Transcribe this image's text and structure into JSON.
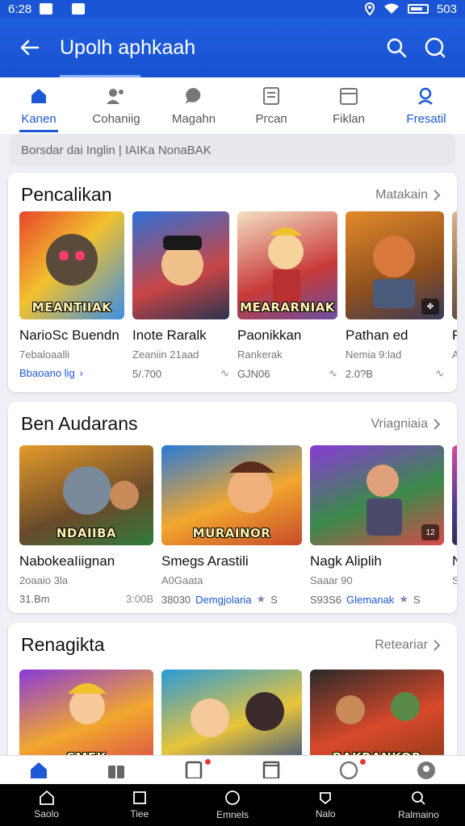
{
  "status_bar": {
    "time": "6:28",
    "battery_text": "503"
  },
  "app_bar": {
    "title": "Upolh aphkaah"
  },
  "tabs": [
    {
      "label": "Kanen",
      "icon": "home-icon",
      "state": "active"
    },
    {
      "label": "Cohaniig",
      "icon": "people-icon"
    },
    {
      "label": "Magahn",
      "icon": "chat-icon"
    },
    {
      "label": "Ргсап",
      "icon": "bookmark-icon"
    },
    {
      "label": "Fiklan",
      "icon": "calendar-icon"
    },
    {
      "label": "Fresatil",
      "icon": "search-person-icon"
    }
  ],
  "search": {
    "placeholder": "Borsdar dai Inglin | IAIKa NonaBAK"
  },
  "sections": [
    {
      "title": "Pencalikan",
      "more": "Matakain",
      "cards": [
        {
          "name": "NarioSc Buendn",
          "sub": "7ebaloaalli",
          "meta_left": "Bbaoano lig",
          "meta_right": "",
          "thumb_text": "MEANTIIAK",
          "colors": [
            "#e8452c",
            "#f2c12e",
            "#3a8ee6"
          ]
        },
        {
          "name": "Inote Raralk",
          "sub": "Zeaniin 21aad",
          "meta_left": "5/.700",
          "meta_right": "",
          "thumb_text": "",
          "colors": [
            "#2e6fd8",
            "#c94545",
            "#2a3350"
          ]
        },
        {
          "name": "Paonikkan",
          "sub": "Rankerak",
          "meta_left": "GJN06",
          "meta_right": "",
          "thumb_text": "MEARARNIAK",
          "colors": [
            "#f3e0c2",
            "#c83a3a",
            "#6a4fa0"
          ]
        },
        {
          "name": "Pathan ed",
          "sub": "Nemia 9:lad",
          "meta_left": "2.0?B",
          "meta_right": "",
          "thumb_text": "",
          "colors": [
            "#e38a2a",
            "#8e4f1e",
            "#3a3a5a"
          ]
        },
        {
          "name": "Ra",
          "sub": "Ar",
          "meta_left": "",
          "meta_right": "",
          "thumb_text": "",
          "colors": [
            "#d9b68a",
            "#8a6a4a",
            "#5a4a3a"
          ]
        }
      ]
    },
    {
      "title": "Ben Audarans",
      "more": "Vriagniaiа",
      "cards": [
        {
          "name": "NabokeaIiignan",
          "sub": "2oaaio 3la",
          "meta_left": "31.Bm",
          "meta_right": "3:00B",
          "thumb_text": "NDAIIBA",
          "colors": [
            "#e59a2a",
            "#6a4a2a",
            "#2f7a3a"
          ]
        },
        {
          "name": "Smegs Arastili",
          "sub": "A0Gaata",
          "meta_left": "38030",
          "meta_link": "Demgjolaria",
          "meta_star": "S",
          "thumb_text": "MURAINOR",
          "colors": [
            "#2a7ad8",
            "#f2a72e",
            "#c74a2a"
          ]
        },
        {
          "name": "Nagk Aliplih",
          "sub": "Saaar 90",
          "meta_left": "S93S6",
          "meta_link": "Glemanak",
          "meta_star": "S",
          "thumb_text": "",
          "colors": [
            "#8a3ad8",
            "#3a8a4a",
            "#d84a4a"
          ]
        },
        {
          "name": "N",
          "sub": "S",
          "meta_left": "",
          "thumb_text": "",
          "colors": [
            "#d84aa0",
            "#4a3a8a",
            "#2a2a4a"
          ]
        }
      ]
    },
    {
      "title": "Renagikta",
      "more": "Reteariar",
      "cards": [
        {
          "thumb_text": "SMEK",
          "colors": [
            "#8a3ad8",
            "#f2a72e",
            "#d84a4a"
          ]
        },
        {
          "thumb_text": "",
          "colors": [
            "#2a9ad8",
            "#e8c43a",
            "#2a4a8a"
          ]
        },
        {
          "thumb_text": "BAKRANKOR",
          "colors": [
            "#2a2a2a",
            "#d8492a",
            "#8a3a1a"
          ]
        }
      ]
    }
  ],
  "bottom_nav": [
    {
      "icon": "home-icon",
      "active": true,
      "dot": false
    },
    {
      "icon": "gift-icon",
      "active": false,
      "dot": false
    },
    {
      "icon": "tablet-icon",
      "active": false,
      "dot": true
    },
    {
      "icon": "book-icon",
      "active": false,
      "dot": false
    },
    {
      "icon": "compass-icon",
      "active": false,
      "dot": true
    },
    {
      "icon": "profile-icon",
      "active": false,
      "dot": false
    }
  ],
  "system_nav": [
    {
      "label": "Saolo",
      "icon": "home-outline-icon"
    },
    {
      "label": "Tiee",
      "icon": "square-icon"
    },
    {
      "label": "Emnels",
      "icon": "circle-icon"
    },
    {
      "label": "Nalo",
      "icon": "back-triangle-icon"
    },
    {
      "label": "Ralmaino",
      "icon": "search-icon"
    }
  ],
  "colors": {
    "primary": "#1c58d8",
    "appbar": "#1f5ee0",
    "background": "#eef0f5"
  }
}
